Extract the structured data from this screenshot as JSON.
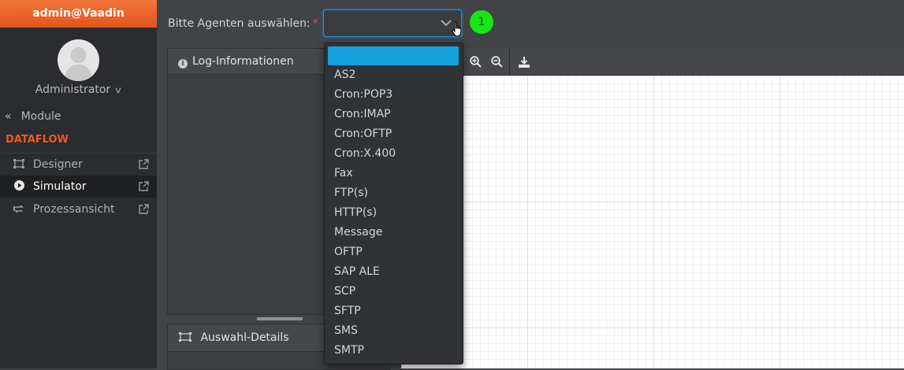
{
  "sidebar": {
    "user": "admin@Vaadin",
    "role": "Administrator",
    "modules_label": "Module",
    "section": "DATAFLOW",
    "items": [
      {
        "label": "Designer"
      },
      {
        "label": "Simulator"
      },
      {
        "label": "Prozessansicht"
      }
    ]
  },
  "agent_select": {
    "label": "Bitte Agenten auswählen:",
    "required_mark": "*",
    "value": "",
    "step": "1",
    "options": [
      "AS2",
      "Cron:POP3",
      "Cron:IMAP",
      "Cron:OFTP",
      "Cron:X.400",
      "Fax",
      "FTP(s)",
      "HTTP(s)",
      "Message",
      "OFTP",
      "SAP ALE",
      "SCP",
      "SFTP",
      "SMS",
      "SMTP"
    ]
  },
  "panels": {
    "log_title": "Log-Informationen",
    "details_title": "Auswahl-Details"
  },
  "colors": {
    "accent": "#ef5a22",
    "selection": "#13a0dc",
    "badge": "#17e617"
  }
}
